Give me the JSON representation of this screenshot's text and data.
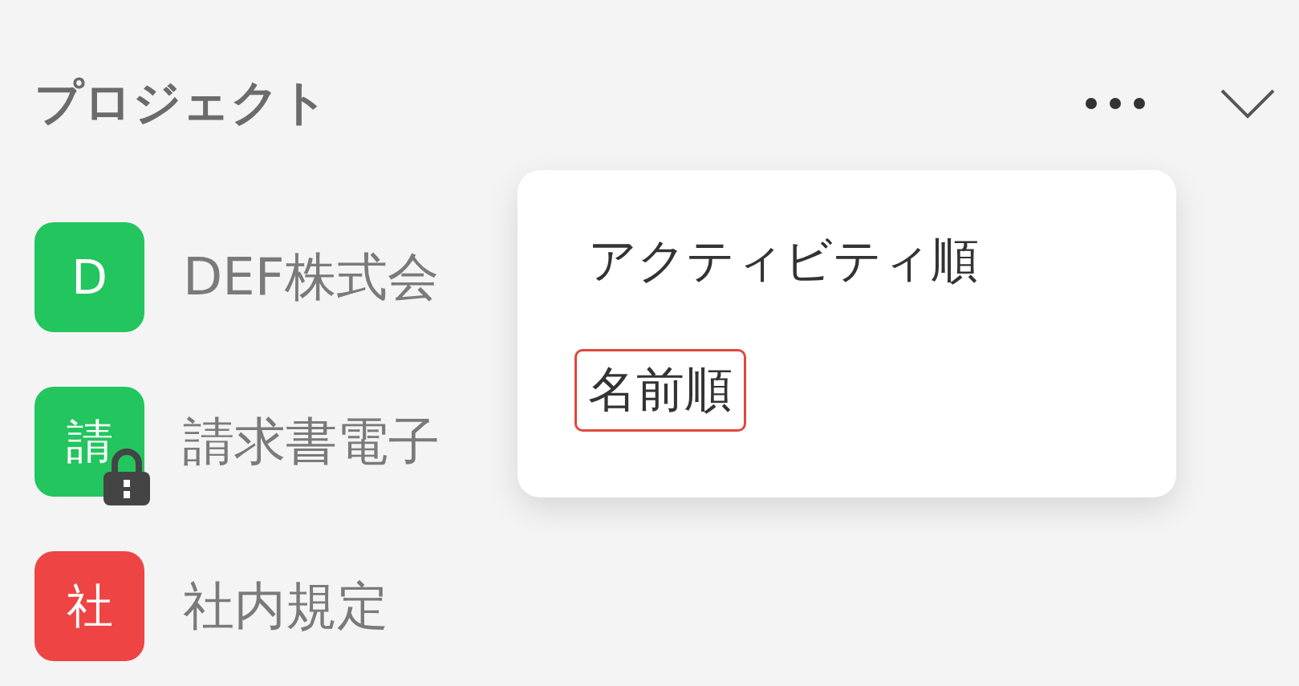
{
  "section": {
    "title": "プロジェクト"
  },
  "projects": [
    {
      "initial": "D",
      "name": "DEF株式会",
      "color": "#22c55e",
      "locked": false
    },
    {
      "initial": "請",
      "name": "請求書電子",
      "color": "#22c55e",
      "locked": true
    },
    {
      "initial": "社",
      "name": "社内規定",
      "color": "#ef4444",
      "locked": false
    }
  ],
  "sort_menu": {
    "items": [
      {
        "label": "アクティビティ順",
        "highlighted": false
      },
      {
        "label": "名前順",
        "highlighted": true
      }
    ]
  }
}
